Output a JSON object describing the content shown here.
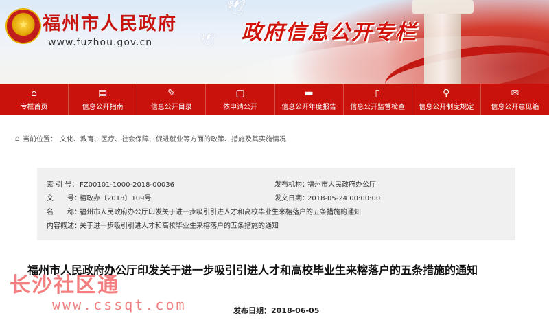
{
  "header": {
    "site_title": "福州市人民政府",
    "site_url": "www.fuzhou.gov.cn",
    "column_title": "政府信息公开专栏",
    "emblem_symbol": "★"
  },
  "nav": {
    "items": [
      {
        "label": "专栏首页",
        "icon": "home-icon",
        "glyph": "⌂"
      },
      {
        "label": "信息公开指南",
        "icon": "guide-icon",
        "glyph": "▤"
      },
      {
        "label": "信息公开目录",
        "icon": "catalog-icon",
        "glyph": "✎"
      },
      {
        "label": "依申请公开",
        "icon": "document-icon",
        "glyph": "▢"
      },
      {
        "label": "信息公开年度报告",
        "icon": "folder-icon",
        "glyph": "▬"
      },
      {
        "label": "信息公开监督检查",
        "icon": "clipboard-icon",
        "glyph": "▯"
      },
      {
        "label": "信息公开制度规定",
        "icon": "search-icon",
        "glyph": "⚲"
      },
      {
        "label": "信息公开意见箱",
        "icon": "mailbox-icon",
        "glyph": "✉"
      }
    ]
  },
  "breadcrumb": {
    "prefix": "当前位置：",
    "items": [
      "文化、教育、医疗、社会保障、促进就业等方面的政策、措施及其实施情况"
    ]
  },
  "meta": {
    "index_label": "索 引 号：",
    "index_value": "FZ00101-1000-2018-00036",
    "publisher_label": "发布机构：",
    "publisher_value": "福州市人民政府办公厅",
    "docno_label": "文　　号：",
    "docno_value": "榕政办〔2018〕109号",
    "docdate_label": "发文日期：",
    "docdate_value": "2018-05-24 00:00:00",
    "name_label": "名　　称：",
    "name_value": "福州市人民政府办公厅印发关于进一步吸引引进人才和高校毕业生来榕落户的五条措施的通知",
    "summary_label": "内容概述：",
    "summary_value": "关于进一步吸引引进人才和高校毕业生来榕落户的五条措施的通知"
  },
  "document": {
    "title": "福州市人民政府办公厅印发关于进一步吸引引进人才和高校毕业生来榕落户的五条措施的通知",
    "publish_date": "发布日期：2018-06-05"
  },
  "watermark": {
    "name": "长沙社区通",
    "url": "www.cssqt.com"
  },
  "colors": {
    "nav_red": "#c8120b",
    "title_red": "#c8140e",
    "meta_bg": "#f0f0f0"
  }
}
